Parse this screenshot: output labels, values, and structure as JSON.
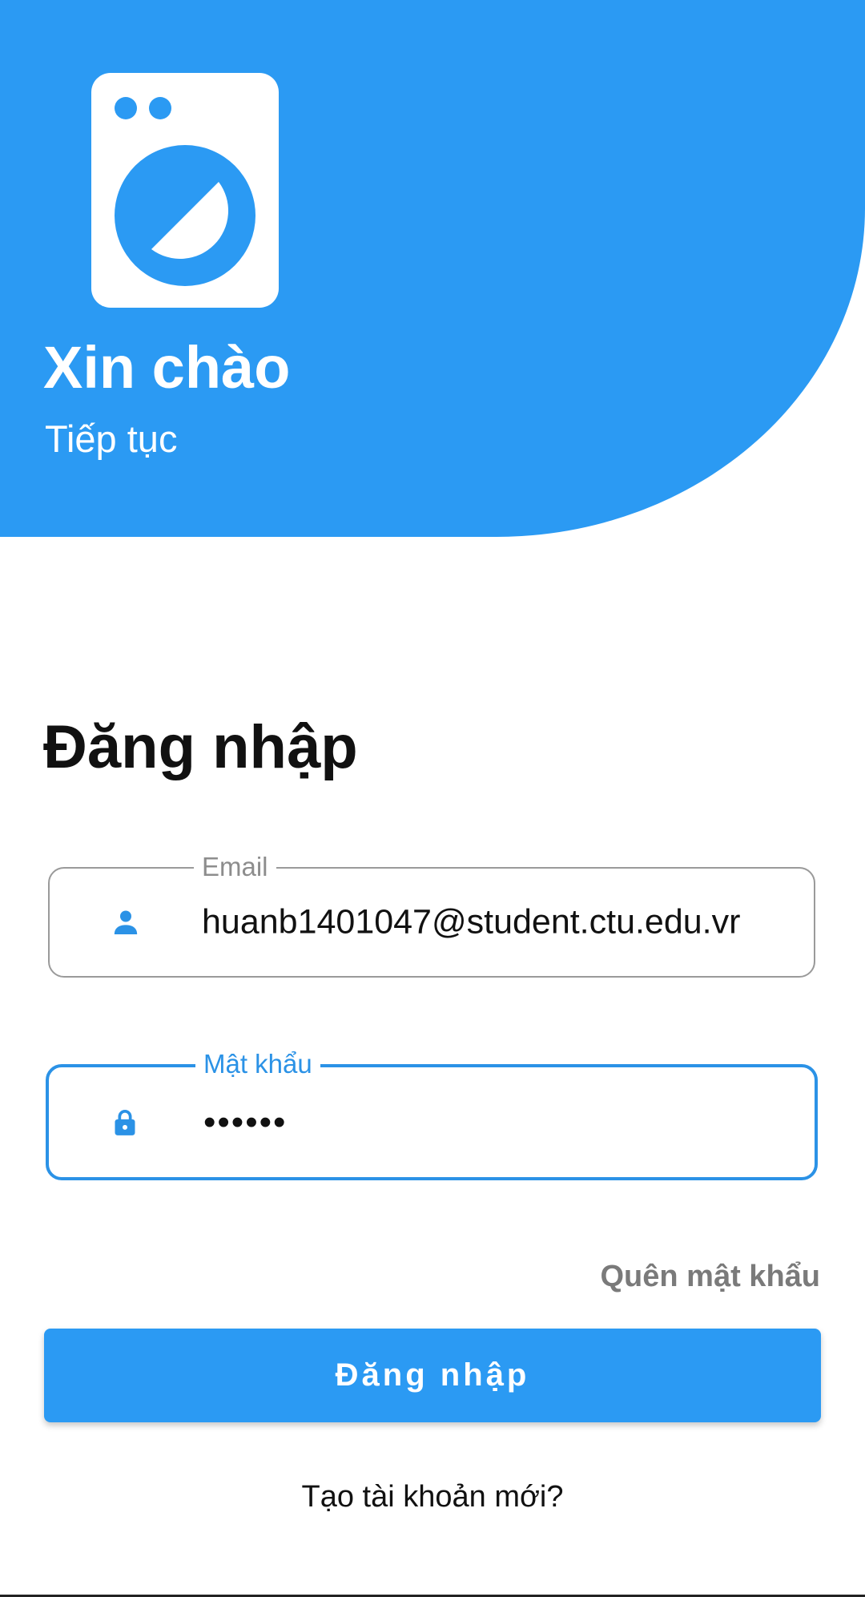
{
  "header": {
    "greeting": "Xin chào",
    "subtitle": "Tiếp tục",
    "logo_icon": "washing-machine-icon"
  },
  "login": {
    "title": "Đăng nhập",
    "email": {
      "label": "Email",
      "value": "huanb1401047@student.ctu.edu.vr",
      "icon": "person-icon"
    },
    "password": {
      "label": "Mật khẩu",
      "value": "••••••",
      "icon": "lock-icon"
    },
    "forgot_label": "Quên mật khẩu",
    "submit_label": "Đăng nhập",
    "register_label": "Tạo tài khoản mới?"
  },
  "colors": {
    "primary": "#2b9af3",
    "focused_border": "#2b92e6",
    "muted_text": "#7a7a7a"
  }
}
